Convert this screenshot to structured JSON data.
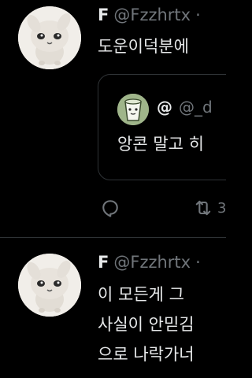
{
  "colors": {
    "background": "#000000",
    "primary_text": "#e7e9ea",
    "secondary_text": "#71767b",
    "border": "#2f3336"
  },
  "tweets": [
    {
      "display_name": "F",
      "handle": "@Fzzhrtx",
      "separator": "·",
      "avatar_icon": "white-bunny-avatar",
      "text_lines": [
        "도운이덕분에"
      ],
      "quote": {
        "display_name": "@",
        "handle": "@_d",
        "avatar_icon": "green-cup-character-avatar",
        "text": "앙콘 말고 히"
      },
      "actions": {
        "reply_icon": "reply-bubble-icon",
        "retweet_icon": "retweet-icon",
        "retweet_count": "3"
      }
    },
    {
      "display_name": "F",
      "handle": "@Fzzhrtx",
      "separator": "·",
      "avatar_icon": "white-bunny-avatar",
      "text_lines": [
        "이 모든게 그",
        "사실이 안믿김",
        "으로 나락가너"
      ]
    }
  ]
}
